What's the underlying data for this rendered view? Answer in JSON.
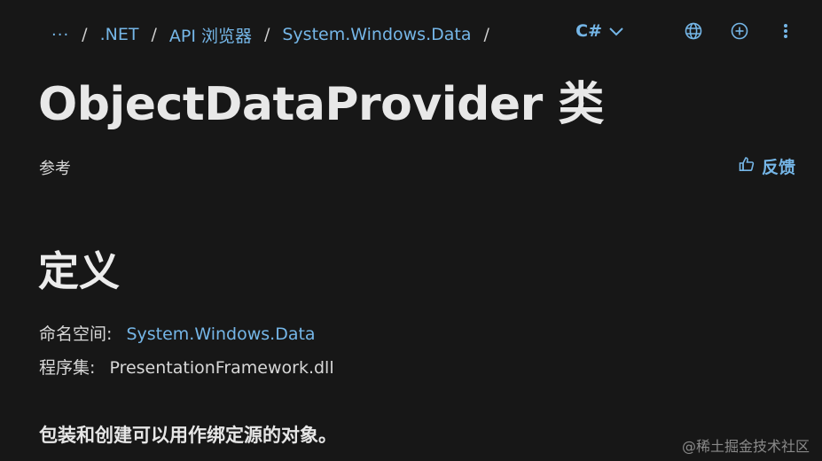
{
  "breadcrumb": {
    "more": "···",
    "items": [
      ".NET",
      "API 浏览器",
      "System.Windows.Data"
    ],
    "separator": "/"
  },
  "toolbar": {
    "language": "C#",
    "icons": [
      "chevron-down-icon",
      "globe-icon",
      "add-circle-icon",
      "more-vertical-icon"
    ]
  },
  "page": {
    "title": "ObjectDataProvider 类",
    "subtitle": "参考",
    "feedback": "反馈"
  },
  "definition": {
    "heading": "定义",
    "namespace_label": "命名空间:",
    "namespace_value": "System.Windows.Data",
    "assembly_label": "程序集:",
    "assembly_value": "PresentationFramework.dll",
    "summary": "包装和创建可以用作绑定源的对象。"
  },
  "watermark": "@稀土掘金技术社区",
  "colors": {
    "background": "#171717",
    "link": "#75b6e7",
    "text": "#e6e6e6"
  }
}
